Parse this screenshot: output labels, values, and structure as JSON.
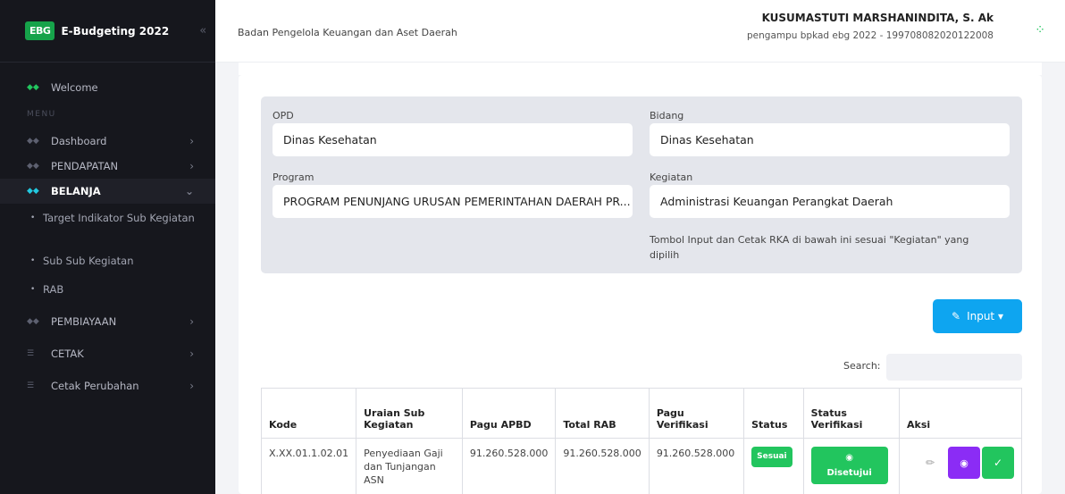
{
  "app": {
    "logo": "EBG",
    "title": "E-Budgeting 2022",
    "collapse_icon": "«"
  },
  "header": {
    "org": "Badan Pengelola Keuangan dan Aset Daerah",
    "user_name": "KUSUMASTUTI MARSHANINDITA, S. Ak",
    "user_role": "pengampu bpkad ebg 2022 - 199708082020122008"
  },
  "sidebar": {
    "welcome": "Welcome",
    "menu_heading": "MENU",
    "items": [
      {
        "label": "Dashboard"
      },
      {
        "label": "PENDAPATAN"
      },
      {
        "label": "BELANJA"
      },
      {
        "label": "PEMBIAYAAN"
      },
      {
        "label": "CETAK"
      },
      {
        "label": "Cetak Perubahan"
      }
    ],
    "sub_items": [
      {
        "label": "Target Indikator Sub Kegiatan"
      },
      {
        "label": "Sub Sub Kegiatan"
      },
      {
        "label": "RAB"
      }
    ]
  },
  "filter": {
    "opd_label": "OPD",
    "opd_value": "Dinas Kesehatan",
    "bidang_label": "Bidang",
    "bidang_value": "Dinas Kesehatan",
    "program_label": "Program",
    "program_value": "PROGRAM PENUNJANG URUSAN PEMERINTAHAN DAERAH PR...",
    "kegiatan_label": "Kegiatan",
    "kegiatan_value": "Administrasi Keuangan Perangkat Daerah",
    "note": "Tombol Input dan Cetak RKA di bawah ini sesuai \"Kegiatan\" yang dipilih"
  },
  "actions": {
    "input_label": "Input ▾"
  },
  "search": {
    "label": "Search:"
  },
  "table": {
    "headers": [
      "Kode",
      "Uraian Sub Kegiatan",
      "Pagu APBD",
      "Total RAB",
      "Pagu Verifikasi",
      "Status",
      "Status Verifikasi",
      "Aksi"
    ],
    "rows": [
      {
        "kode": "X.XX.01.1.02.01",
        "uraian": "Penyediaan Gaji dan Tunjangan ASN",
        "pagu_apbd": "91.260.528.000",
        "total_rab": "91.260.528.000",
        "pagu_verifikasi": "91.260.528.000",
        "status": "Sesuai",
        "status_verifikasi": "Disetujui"
      }
    ]
  }
}
